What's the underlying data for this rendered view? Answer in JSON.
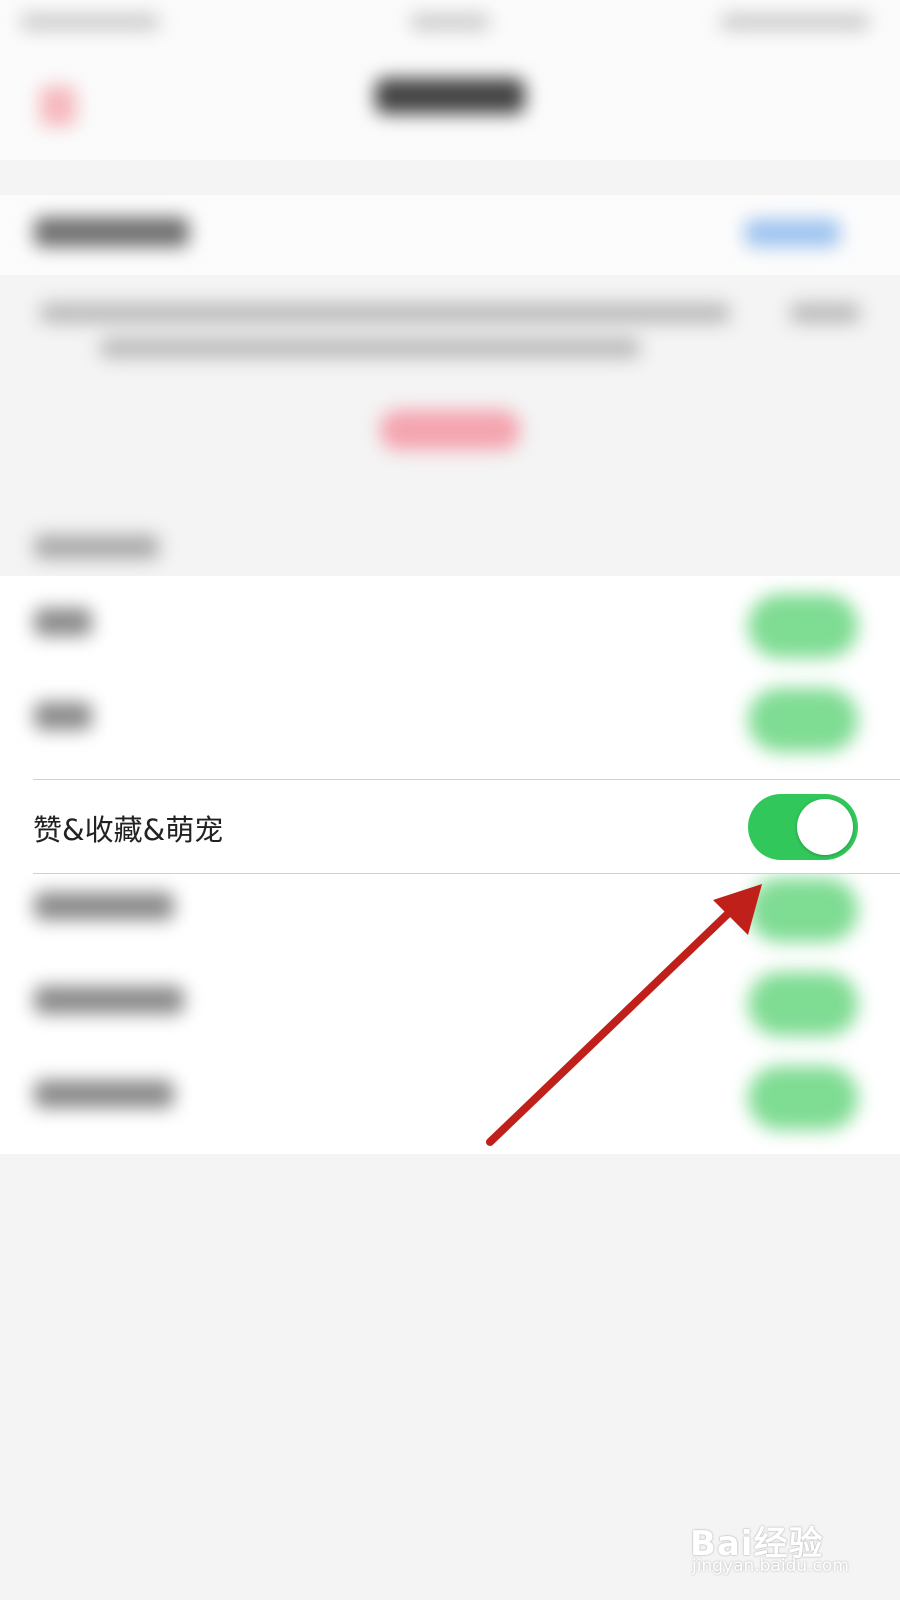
{
  "settings": {
    "highlighted_row": {
      "label": "赞&收藏&萌宠",
      "toggle_state": "on"
    }
  },
  "colors": {
    "toggle_on": "#31c75a",
    "arrow": "#c0201a",
    "background": "#f4f4f4"
  },
  "watermark": {
    "brand": "Bai经验",
    "url": "jingyan.baidu.com"
  }
}
